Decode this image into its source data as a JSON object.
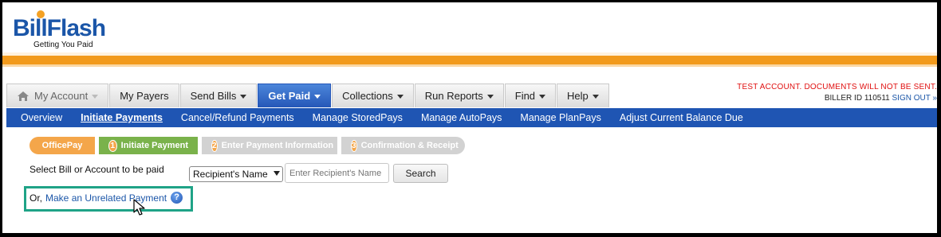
{
  "logo": {
    "name": "BillFlash",
    "tagline": "Getting You Paid"
  },
  "notice": "TEST ACCOUNT. DOCUMENTS WILL NOT BE SENT.",
  "biller": {
    "id_text": "BILLER ID 110511",
    "sign_out": "SIGN OUT »"
  },
  "tabs": [
    {
      "label": "My Account"
    },
    {
      "label": "My Payers"
    },
    {
      "label": "Send Bills"
    },
    {
      "label": "Get Paid"
    },
    {
      "label": "Collections"
    },
    {
      "label": "Run Reports"
    },
    {
      "label": "Find"
    },
    {
      "label": "Help"
    }
  ],
  "subnav": [
    {
      "label": "Overview"
    },
    {
      "label": "Initiate Payments"
    },
    {
      "label": "Cancel/Refund Payments"
    },
    {
      "label": "Manage StoredPays"
    },
    {
      "label": "Manage AutoPays"
    },
    {
      "label": "Manage PlanPays"
    },
    {
      "label": "Adjust Current Balance Due"
    }
  ],
  "steps": [
    {
      "label": "OfficePay"
    },
    {
      "num": "1",
      "label": "Initiate Payment"
    },
    {
      "num": "2",
      "label": "Enter Payment Information"
    },
    {
      "num": "3",
      "label": "Confirmation & Receipt"
    }
  ],
  "form": {
    "select_label": "Select Bill or Account to be paid",
    "select_value": "Recipient's Name",
    "input_placeholder": "Enter Recipient's Name",
    "search_button": "Search",
    "or_prefix": "Or,",
    "unrelated_link": "Make an Unrelated Payment",
    "help_glyph": "?"
  },
  "colors": {
    "brand_blue": "#1f55b3",
    "accent_orange": "#f29a1c",
    "step_green": "#7ab24b",
    "highlight": "#1fa387",
    "warning_red": "#e01010"
  }
}
